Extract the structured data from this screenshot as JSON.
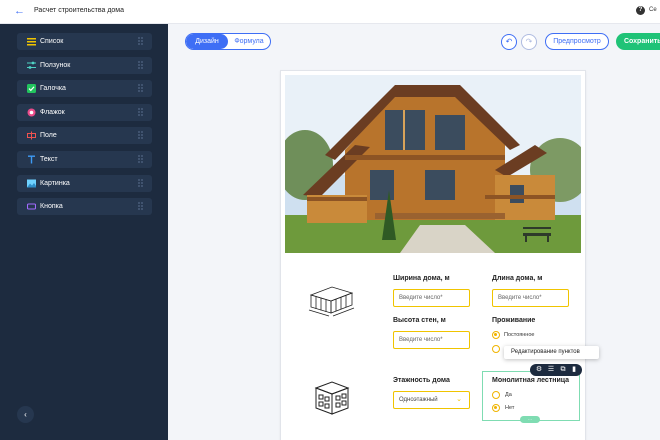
{
  "topbar": {
    "back_icon": "arrow-left-icon",
    "title": "Расчет строительства дома",
    "help_label": "Се"
  },
  "sidebar": {
    "items": [
      {
        "label": "Список",
        "icon": "list-icon",
        "color": "#f0c400"
      },
      {
        "label": "Ползунок",
        "icon": "sliders-icon",
        "color": "#4fd3c4"
      },
      {
        "label": "Галочка",
        "icon": "checkbox-icon",
        "color": "#22c55e"
      },
      {
        "label": "Флажок",
        "icon": "radio-icon",
        "color": "#e94b8a"
      },
      {
        "label": "Поле",
        "icon": "field-icon",
        "color": "#ef5350"
      },
      {
        "label": "Текст",
        "icon": "text-icon",
        "color": "#3e9bf5"
      },
      {
        "label": "Картинка",
        "icon": "image-icon",
        "color": "#6fd2ff"
      },
      {
        "label": "Кнопка",
        "icon": "button-icon",
        "color": "#a26bff"
      }
    ],
    "collapse_icon": "chevron-left-icon"
  },
  "toolbar": {
    "mode_design": "Дизайн",
    "mode_formula": "Формула",
    "undo_icon": "undo-icon",
    "redo_icon": "redo-icon",
    "preview_label": "Предпросмотр",
    "save_label": "Сохранить"
  },
  "form": {
    "width_label": "Ширина дома, м",
    "width_placeholder": "Введите число*",
    "length_label": "Длина дома, м",
    "length_placeholder": "Введите число*",
    "height_label": "Высота стен, м",
    "height_placeholder": "Введите число*",
    "living_label": "Проживание",
    "living_options": [
      {
        "label": "Постоянное",
        "checked": true
      },
      {
        "label": "",
        "checked": false
      }
    ],
    "floors_label": "Этажность дома",
    "floors_value": "Одноэтажный",
    "stairs_label": "Монолитная лестница",
    "stairs_options": [
      {
        "label": "Да",
        "checked": false
      },
      {
        "label": "Нет",
        "checked": true
      }
    ]
  },
  "tooltip": "Редактирование пунктов",
  "selection_handle": "⋯"
}
